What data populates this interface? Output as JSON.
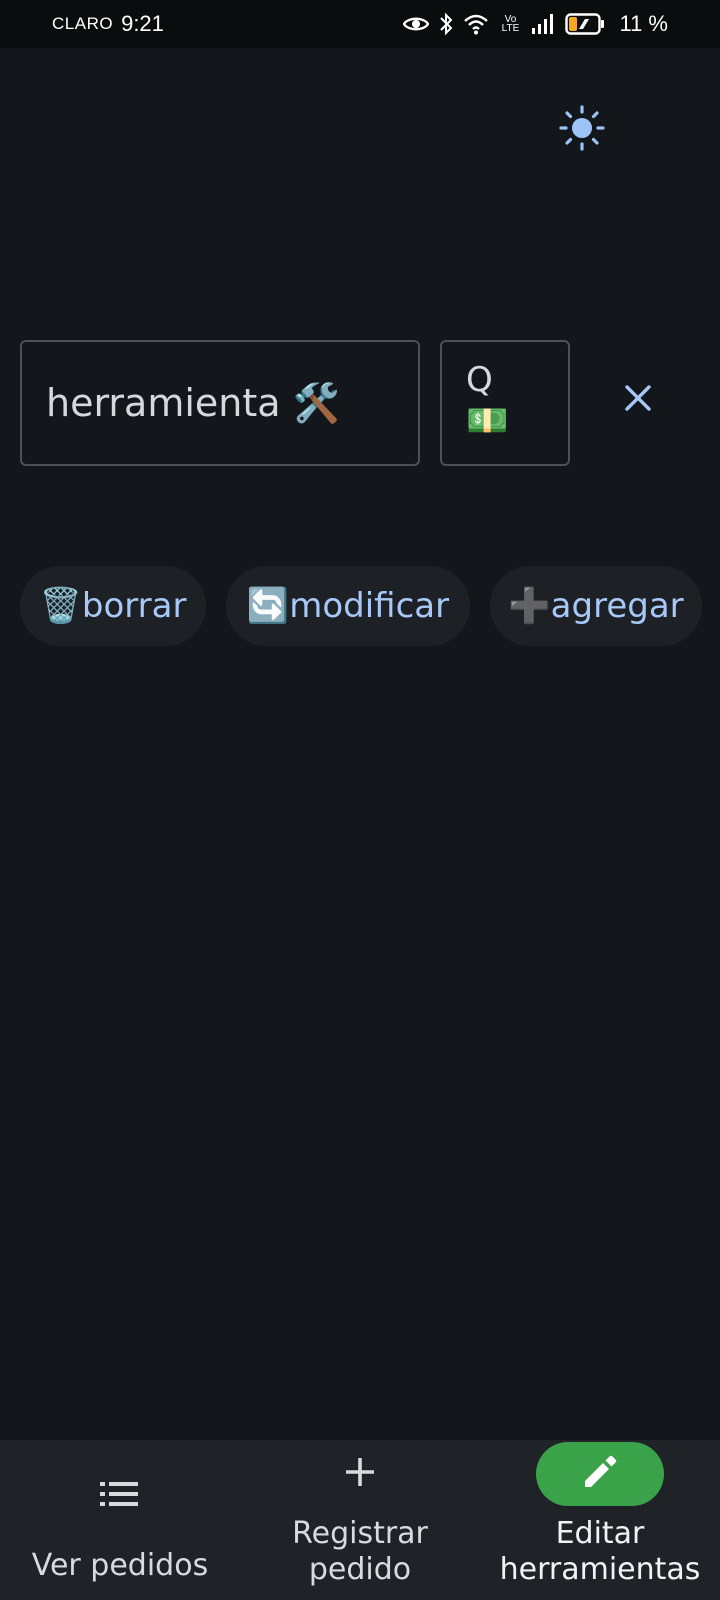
{
  "status_bar": {
    "carrier": "CLARO",
    "time": "9:21",
    "network": "Vo LTE",
    "battery_percent": "11 %"
  },
  "form": {
    "name_value": "herramienta 🛠️",
    "price_value": "Q\n💵"
  },
  "actions": {
    "delete_label": "🗑️borrar",
    "modify_label": "🔄modificar",
    "add_label": "➕agregar"
  },
  "bottom_nav": {
    "orders_label": "Ver pedidos",
    "register_label": "Registrar\npedido",
    "edit_label": "Editar\nherramientas",
    "active": "edit"
  },
  "colors": {
    "background": "#13161b",
    "accent_blue": "#a8c8f8",
    "active_pill": "#3aa34a"
  },
  "icons": [
    "eye-icon",
    "bluetooth-icon",
    "wifi-icon",
    "signal-icon",
    "battery-icon",
    "sun-icon",
    "close-icon",
    "list-icon",
    "plus-icon",
    "pencil-icon"
  ]
}
